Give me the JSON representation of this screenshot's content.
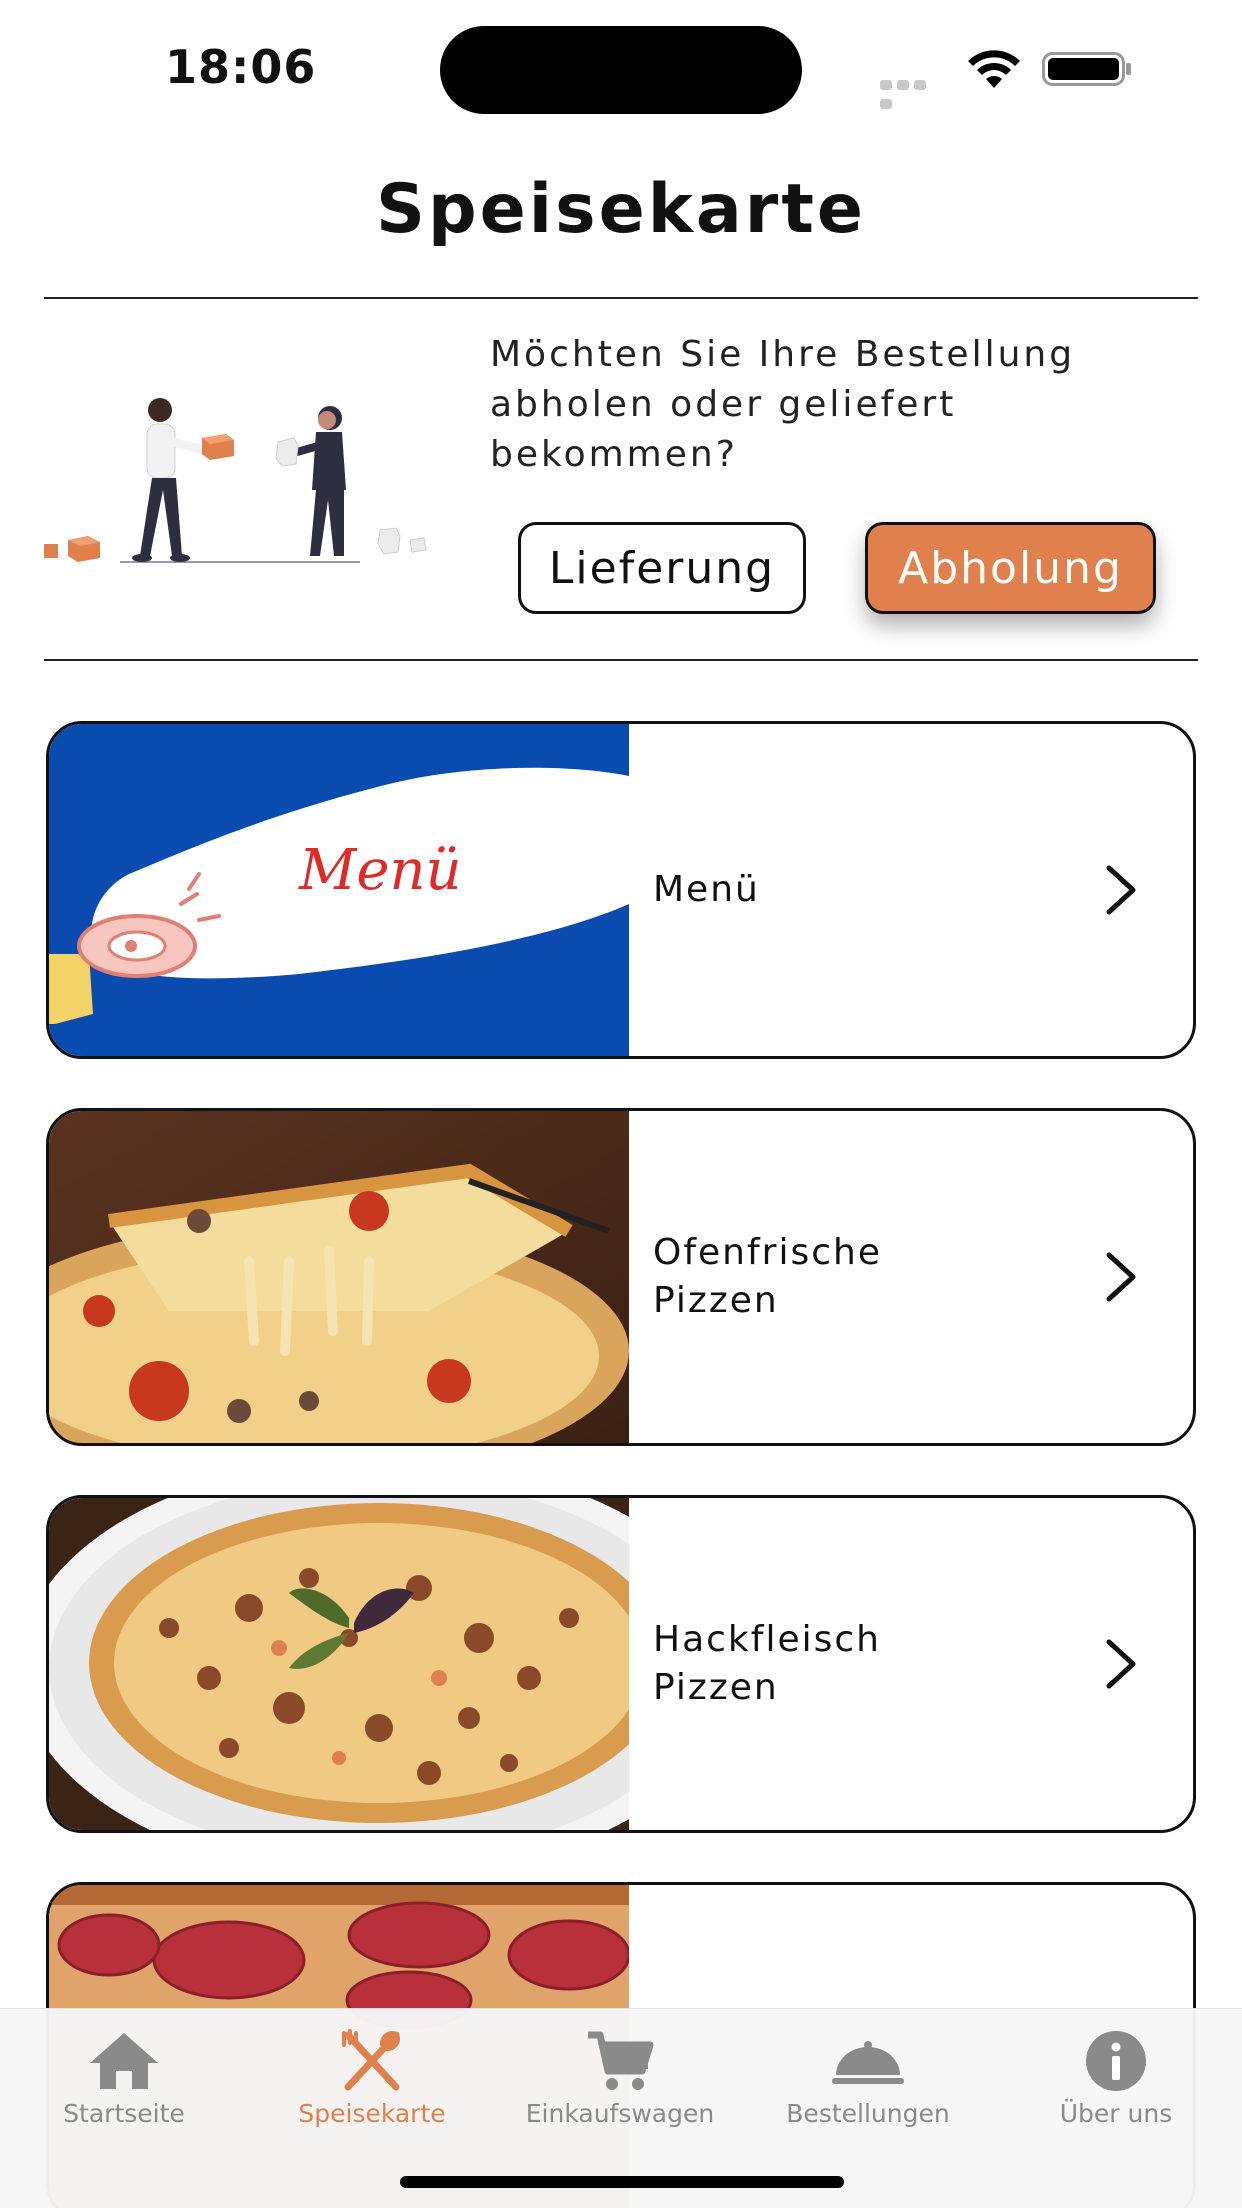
{
  "status": {
    "time": "18:06"
  },
  "page": {
    "title": "Speisekarte"
  },
  "delivery": {
    "question": "Möchten Sie Ihre Bestellung abholen oder geliefert bekommen?",
    "delivery_label": "Lieferung",
    "pickup_label": "Abholung",
    "selected": "Abholung"
  },
  "banner": {
    "text": "Menü"
  },
  "categories": [
    {
      "label": "Menü"
    },
    {
      "label": "Ofenfrische Pizzen"
    },
    {
      "label": "Hackfleisch Pizzen"
    },
    {
      "label": ""
    }
  ],
  "tabs": [
    {
      "label": "Startseite",
      "icon": "home-icon"
    },
    {
      "label": "Speisekarte",
      "icon": "fork-spoon-icon"
    },
    {
      "label": "Einkaufswagen",
      "icon": "cart-icon"
    },
    {
      "label": "Bestellungen",
      "icon": "cloche-icon"
    },
    {
      "label": "Über uns",
      "icon": "info-icon"
    }
  ],
  "colors": {
    "accent": "#e0804d",
    "banner_blue": "#0a4bb0",
    "inactive": "#8a8a8a"
  }
}
